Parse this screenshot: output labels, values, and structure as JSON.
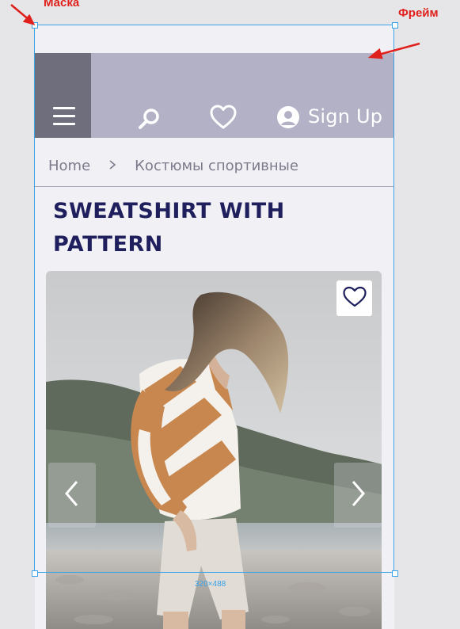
{
  "annotations": {
    "mask_label": "Маска",
    "frame_label": "Фрейм",
    "size_badge": "320×488",
    "accent_color": "#e0201c",
    "selection_color": "#3aa3e8"
  },
  "header": {
    "menu_icon": "hamburger-menu-icon",
    "search_icon": "search-icon",
    "favorites_icon": "heart-icon",
    "account_icon": "user-icon",
    "signup_label": "Sign Up",
    "band_color": "#b3b1c6",
    "menu_color": "#6f6e7d"
  },
  "breadcrumb": {
    "home": "Home",
    "separator": ">",
    "category": "Костюмы спортивные"
  },
  "product": {
    "title_line1": "SWEATSHIRT WITH",
    "title_line2": "PATTERN",
    "title_color": "#1f1f5e",
    "favorite_icon": "heart-icon",
    "prev_icon": "chevron-left-icon",
    "next_icon": "chevron-right-icon"
  }
}
